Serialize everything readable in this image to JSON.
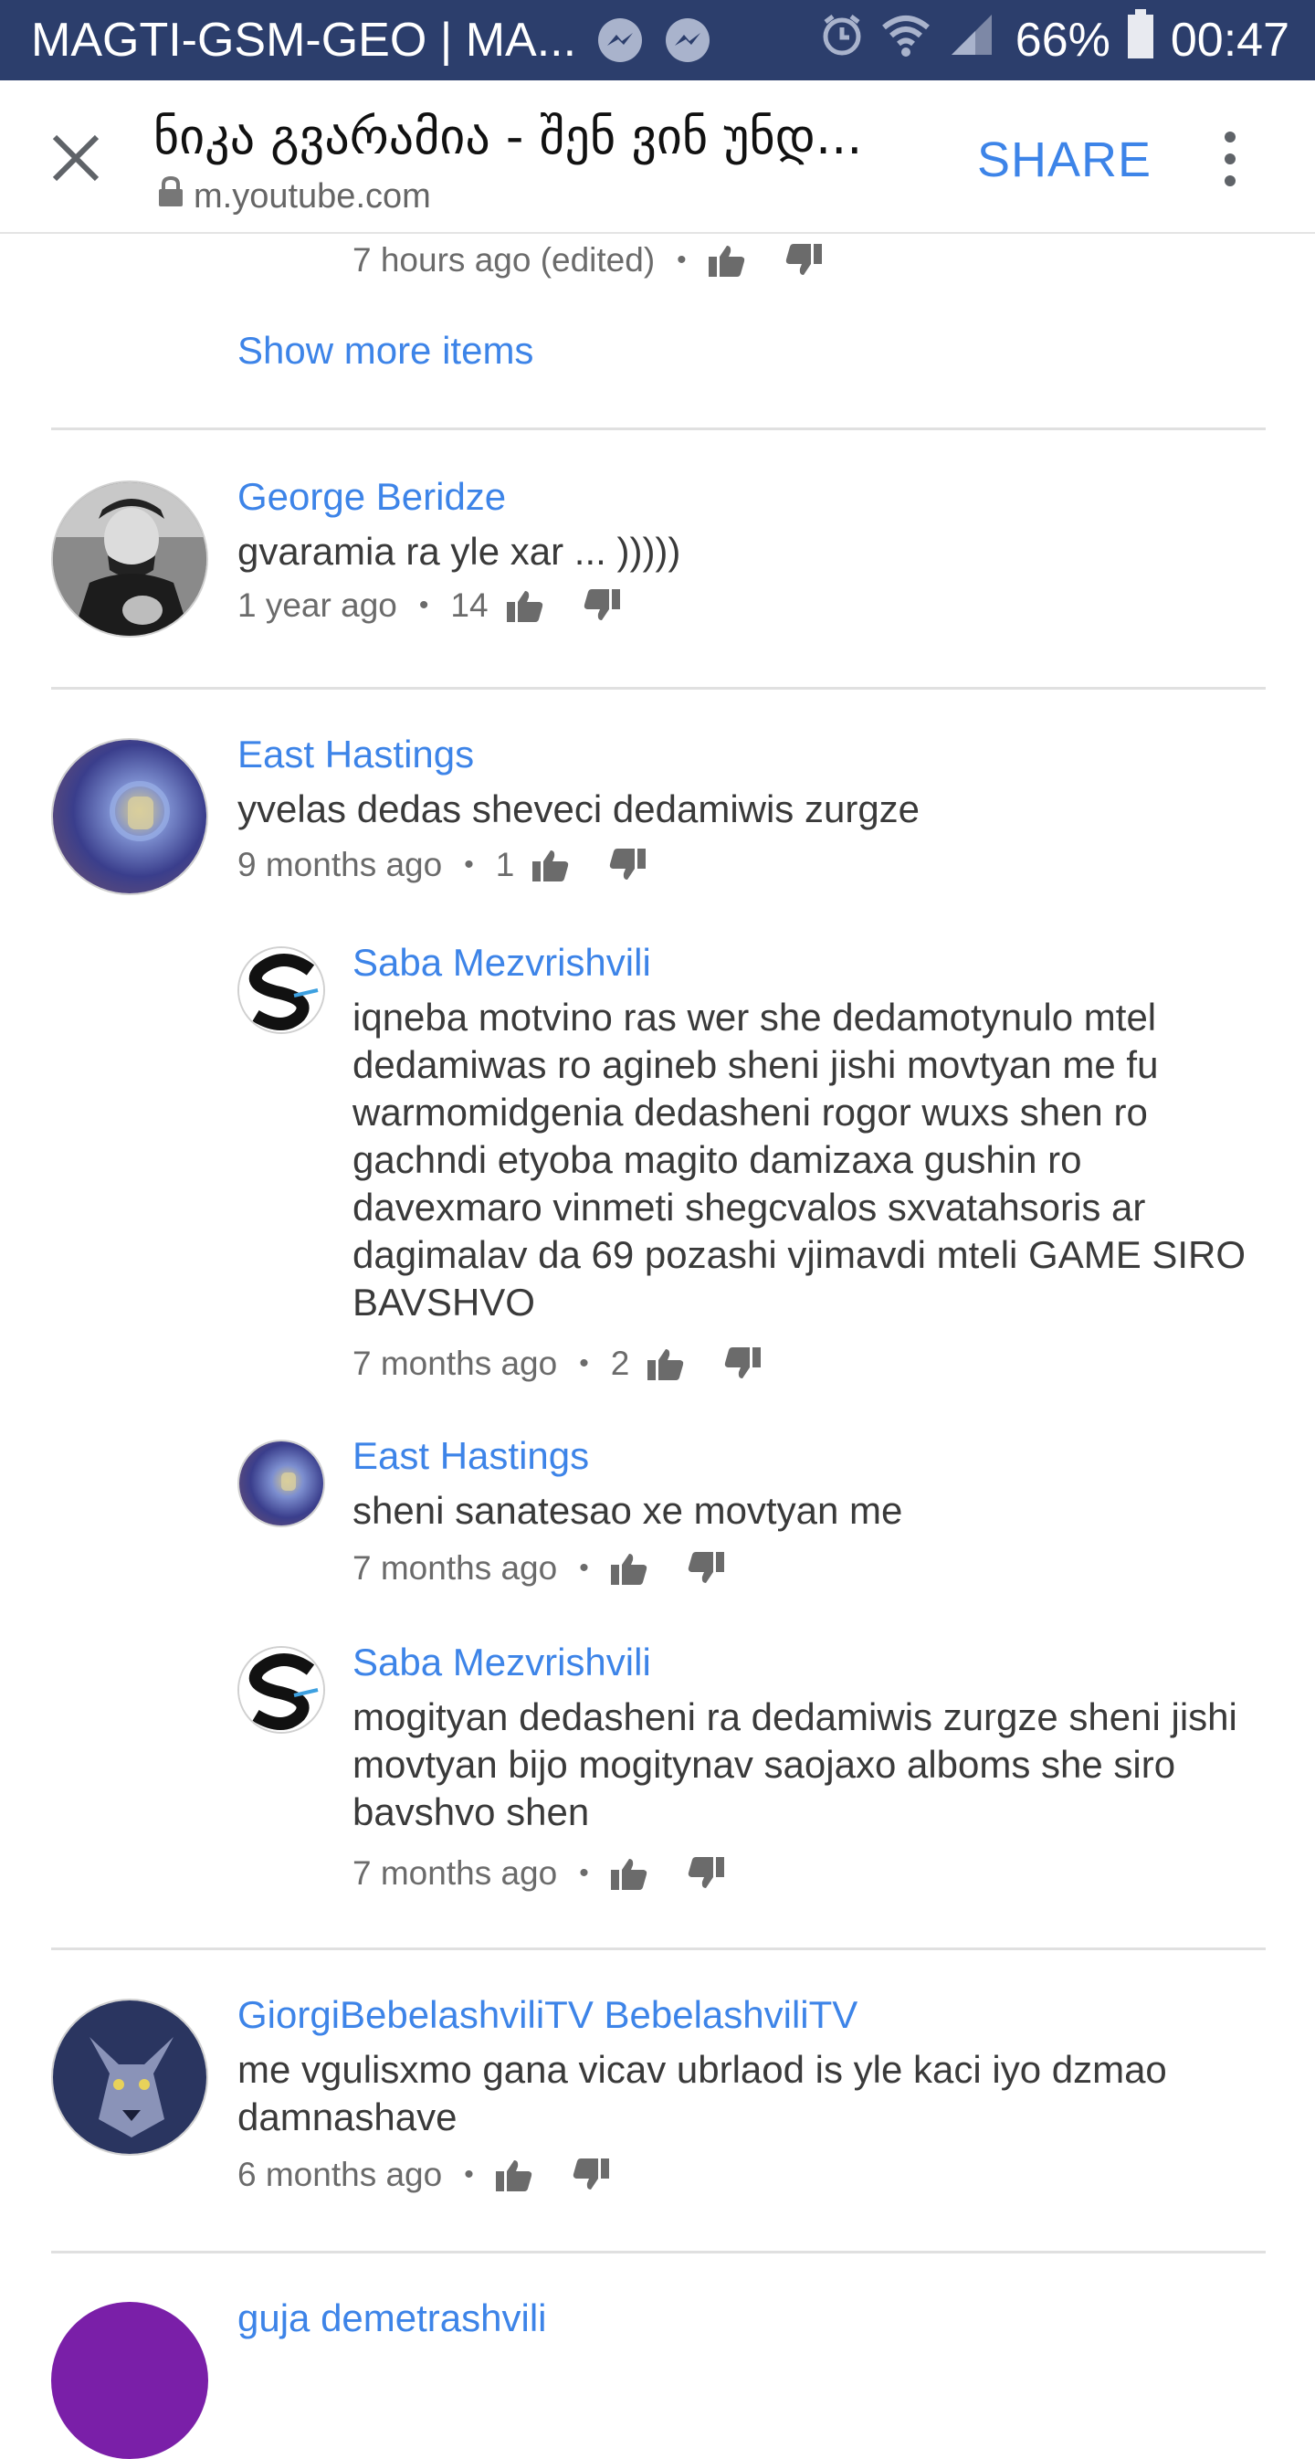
{
  "status_bar": {
    "carrier": "MAGTI-GSM-GEO | MA...",
    "battery": "66%",
    "time": "00:47",
    "icons": [
      "messenger-icon",
      "messenger-icon",
      "alarm-icon",
      "wifi-icon",
      "signal-icon",
      "battery-icon"
    ]
  },
  "toolbar": {
    "title": "ნიკა გვარამია - შენ ვინ უნდ...",
    "url": "m.youtube.com",
    "share_label": "SHARE"
  },
  "top_reply_meta": "7 hours ago (edited)",
  "show_more": "Show more items",
  "comments": [
    {
      "author": "George Beridze",
      "text": "gvaramia ra yle xar ... )))))",
      "time": "1 year ago",
      "likes": "14"
    },
    {
      "author": "East Hastings",
      "text": "yvelas dedas sheveci dedamiwis zurgze",
      "time": "9 months ago",
      "likes": "1",
      "replies": [
        {
          "author": "Saba Mezvrishvili",
          "text": "iqneba motvino ras wer she dedamotynulo mtel dedamiwas ro agineb sheni jishi movtyan me fu warmomidgenia dedasheni rogor wuxs shen ro gachndi etyoba magito damizaxa gushin ro davexmaro vinmeti shegcvalos sxvatahsoris ar dagimalav da 69 pozashi vjimavdi mteli GAME SIRO BAVSHVO",
          "time": "7 months ago",
          "likes": "2"
        },
        {
          "author": "East Hastings",
          "text": "sheni sanatesao xe movtyan me",
          "time": "7 months ago",
          "likes": ""
        },
        {
          "author": "Saba Mezvrishvili",
          "text": "mogityan dedasheni ra dedamiwis zurgze sheni jishi movtyan bijo mogitynav saojaxo alboms she siro bavshvo shen",
          "time": "7 months ago",
          "likes": ""
        }
      ]
    },
    {
      "author": "GiorgiBebelashviliTV BebelashviliTV",
      "text": "me vgulisxmo gana vicav ubrlaod is yle kaci iyo dzmao damnashave",
      "time": "6 months ago",
      "likes": ""
    },
    {
      "author": "guja demetrashvili"
    }
  ],
  "colors": {
    "status_bar": "#2c3e6c",
    "link_blue": "#3d84e8",
    "meta_gray": "#6b6b6b",
    "text": "#3a3a3a",
    "divider": "#e0e0e0"
  }
}
